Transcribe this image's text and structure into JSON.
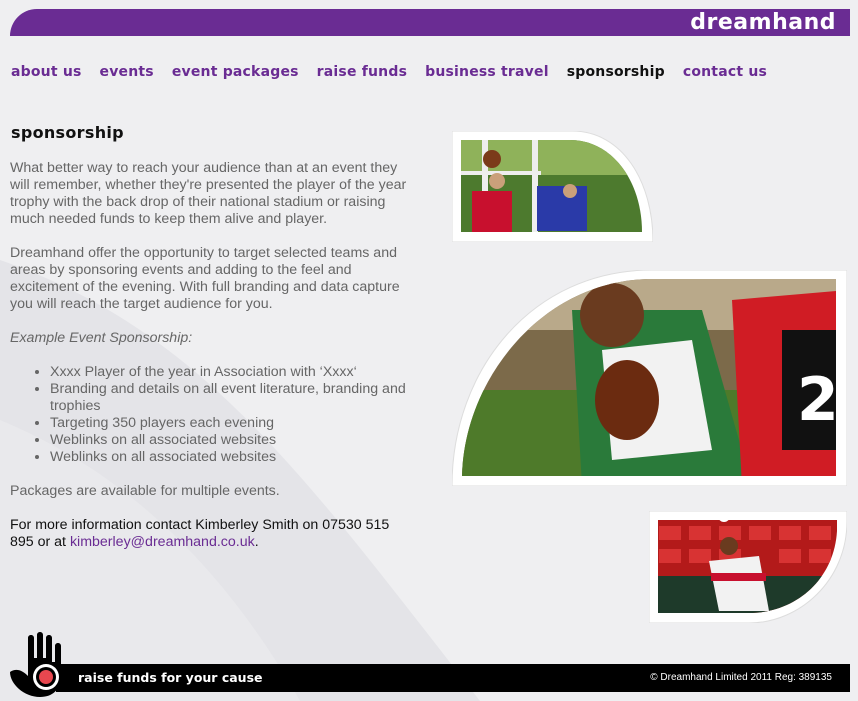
{
  "header": {
    "logo_text": "dreamhand"
  },
  "nav": {
    "items": [
      {
        "label": "about us",
        "active": false
      },
      {
        "label": "events",
        "active": false
      },
      {
        "label": "event packages",
        "active": false
      },
      {
        "label": "raise funds",
        "active": false
      },
      {
        "label": "business travel",
        "active": false
      },
      {
        "label": "sponsorship",
        "active": true
      },
      {
        "label": "contact us",
        "active": false
      }
    ]
  },
  "main": {
    "title": "sponsorship",
    "paragraph1": "What better way to reach your audience than at an event they will remember, whether they're presented the player of the year trophy with the back drop of their national stadium or raising much needed funds to keep them alive and player.",
    "paragraph2": "Dreamhand offer the opportunity to target selected teams and areas by sponsoring events and adding to the feel and excitement of the evening. With full branding and data capture you will reach the target audience for you.",
    "example_heading": "Example Event Sponsorship:",
    "bullets": [
      "Xxxx Player of the year in Association with ‘Xxxx‘",
      "Branding and details on all event literature, branding and trophies",
      "Targeting 350 players each evening",
      "Weblinks on all associated websites",
      "Weblinks on all associated websites"
    ],
    "packages_text": "Packages are available for multiple events.",
    "contact_text": "For more information contact Kimberley Smith on 07530 515 895 or at ",
    "contact_email": "kimberley@dreamhand.co.uk",
    "contact_end": "."
  },
  "footer": {
    "tagline": "raise funds for your cause",
    "copyright": "© Dreamhand Limited 2011 Reg: 389135"
  },
  "colors": {
    "brand_purple": "#6a2c93",
    "footer_black": "#000000",
    "hand_red": "#e8474f"
  }
}
